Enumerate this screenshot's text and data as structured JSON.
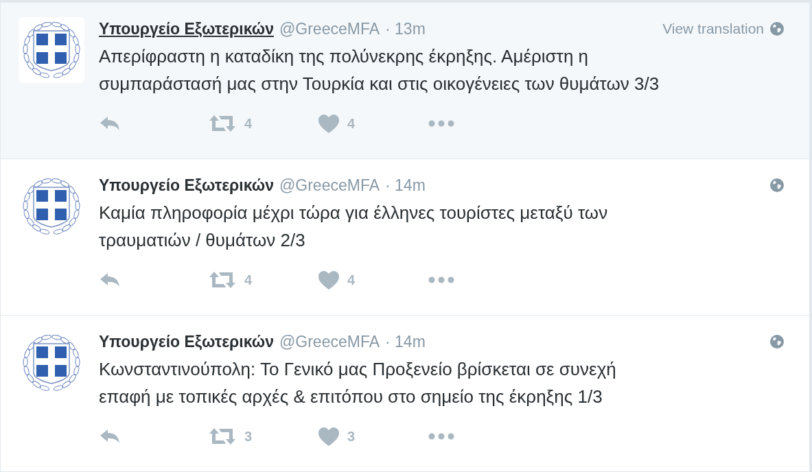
{
  "tweets": [
    {
      "name": "Υπουργείο Εξωτερικών",
      "handle": "@GreeceMFA",
      "time": "· 13m",
      "hovered": true,
      "translation": "View translation",
      "text": "Απερίφραστη η καταδίκη της πολύνεκρης έκρηξης. Αμέριστη η\nσυμπαράστασή μας στην Τουρκία και στις οικογένειες των θυμάτων 3/3",
      "retweets": "4",
      "likes": "4"
    },
    {
      "name": "Υπουργείο Εξωτερικών",
      "handle": "@GreeceMFA",
      "time": "· 14m",
      "hovered": false,
      "text": "Καμία πληροφορία μέχρι τώρα για έλληνες τουρίστες μεταξύ των\nτραυματιών / θυμάτων 2/3",
      "retweets": "4",
      "likes": "4"
    },
    {
      "name": "Υπουργείο Εξωτερικών",
      "handle": "@GreeceMFA",
      "time": "· 14m",
      "hovered": false,
      "text": "Κωνσταντινούπολη: Το Γενικό μας Προξενείο βρίσκεται σε συνεχή\nεπαφή με τοπικές αρχές & επιτόπου στο σημείο της έκρηξης 1/3",
      "retweets": "3",
      "likes": "3"
    }
  ]
}
